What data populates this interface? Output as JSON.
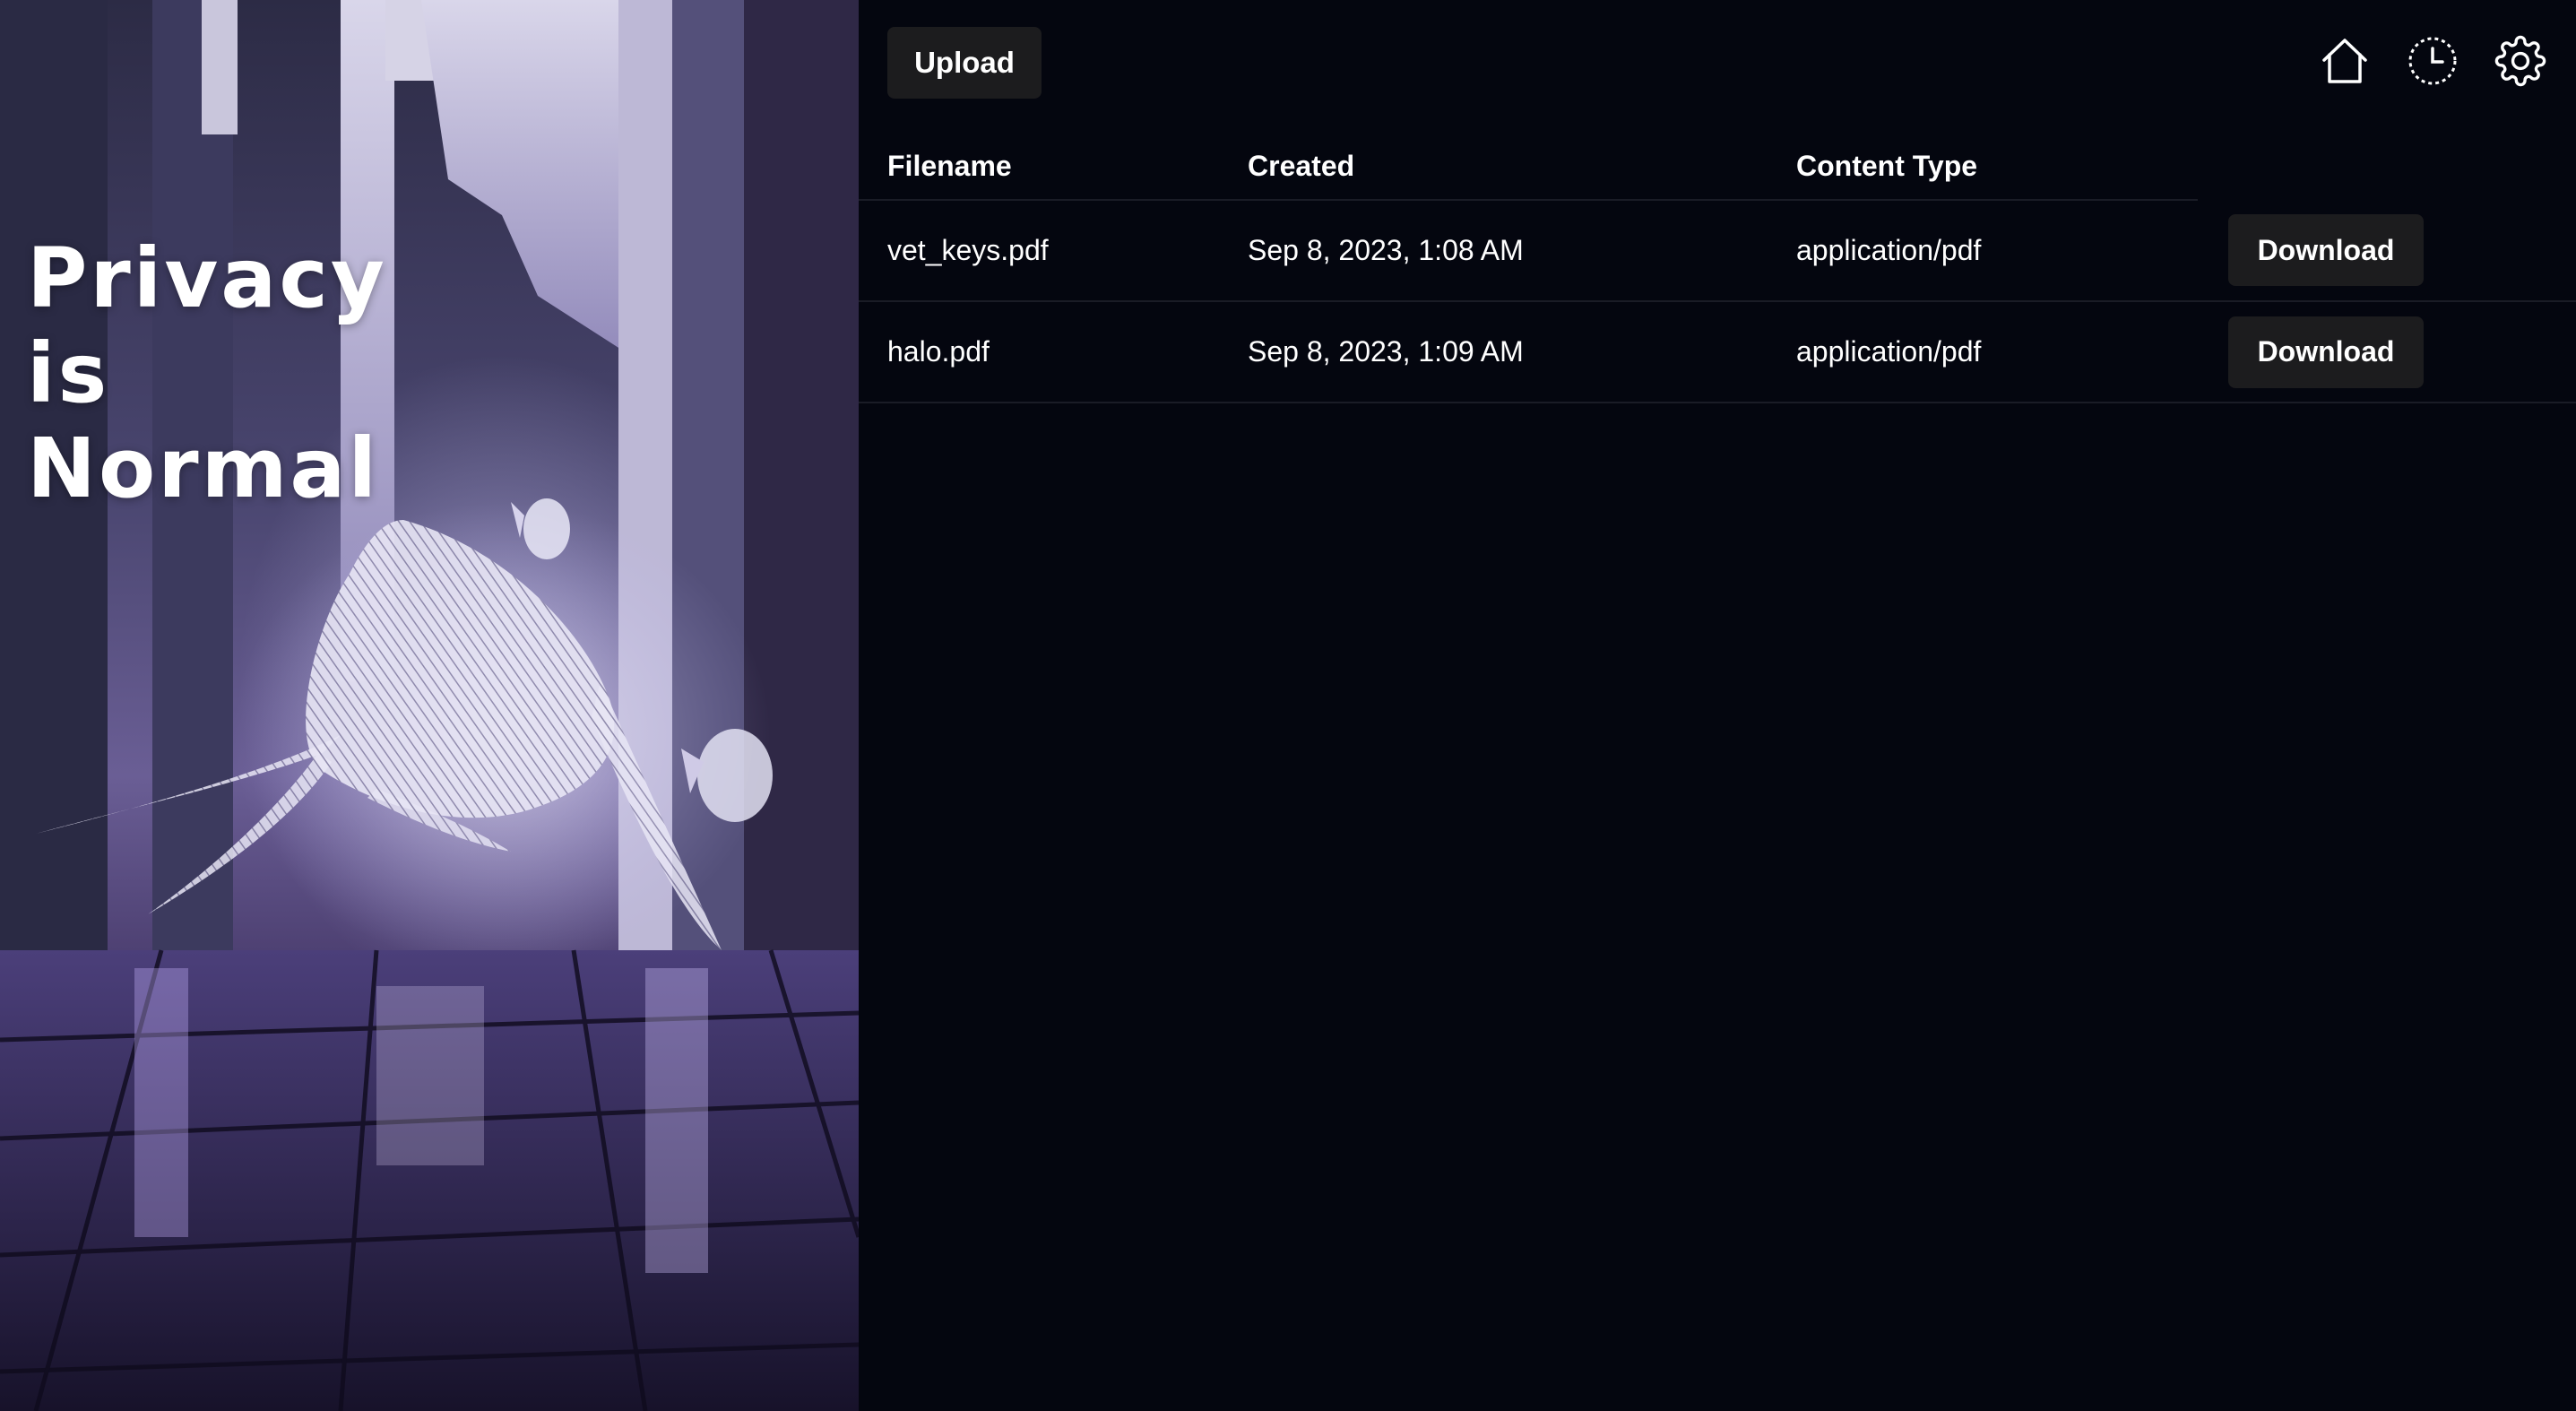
{
  "hero": {
    "title_lines": [
      "Privacy",
      "is",
      "Normal"
    ],
    "image_description_icon": "whale-hologram-illustration"
  },
  "toolbar": {
    "upload_label": "Upload",
    "icons": [
      "home-icon",
      "history-icon",
      "gear-icon"
    ]
  },
  "table": {
    "headers": {
      "filename": "Filename",
      "created": "Created",
      "content_type": "Content Type"
    },
    "rows": [
      {
        "filename": "vet_keys.pdf",
        "created": "Sep 8, 2023, 1:08 AM",
        "content_type": "application/pdf",
        "action_label": "Download"
      },
      {
        "filename": "halo.pdf",
        "created": "Sep 8, 2023, 1:09 AM",
        "content_type": "application/pdf",
        "action_label": "Download"
      }
    ]
  },
  "colors": {
    "background": "#04060f",
    "button_bg": "#1c1c1e",
    "divider": "#1a1c26",
    "text": "#ffffff"
  }
}
